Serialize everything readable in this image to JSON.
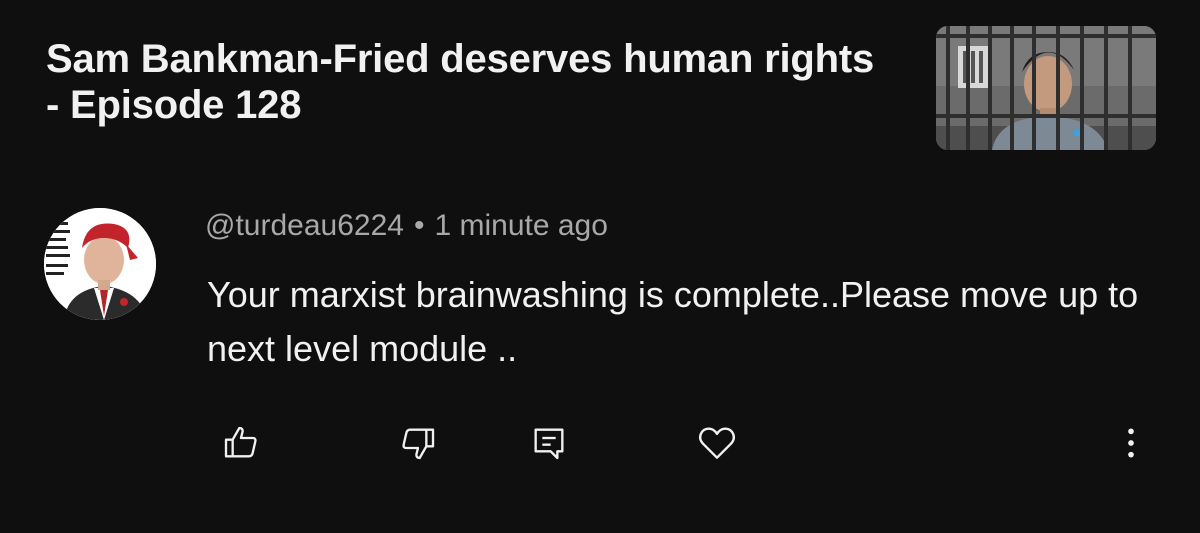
{
  "video": {
    "title": "Sam Bankman-Fried deserves human rights - Episode 128",
    "thumbnail_icon": "video-thumbnail"
  },
  "comment": {
    "author": "@turdeau6224",
    "separator": "•",
    "timestamp": "1 minute ago",
    "text": "Your marxist brainwashing is complete..Please move up to next level module ..",
    "avatar_icon": "avatar-image"
  },
  "actions": {
    "like_icon": "thumbs-up-icon",
    "dislike_icon": "thumbs-down-icon",
    "reply_icon": "reply-comment-icon",
    "heart_icon": "heart-icon",
    "more_icon": "more-vertical-icon"
  },
  "colors": {
    "background": "#0f0f0f",
    "primary_text": "#f1f1f1",
    "secondary_text": "#a8a8a8"
  }
}
